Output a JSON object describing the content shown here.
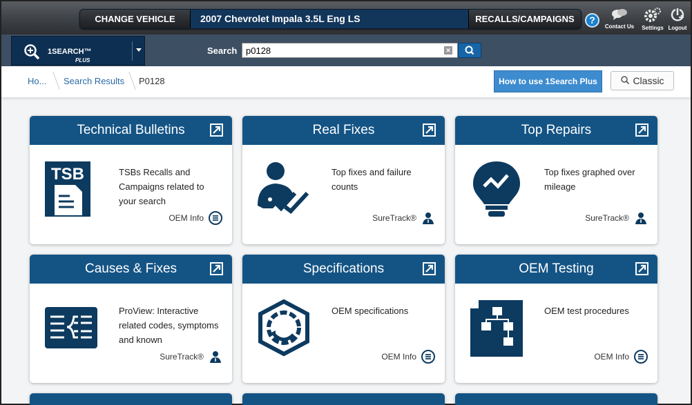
{
  "header": {
    "change_vehicle": "CHANGE VEHICLE",
    "vehicle": "2007 Chevrolet Impala 3.5L Eng LS",
    "recalls": "RECALLS/CAMPAIGNS",
    "help": "?",
    "contact": "Contact Us",
    "settings": "Settings",
    "logout": "Logout"
  },
  "search": {
    "product": "1SEARCH™",
    "product_sub": "PLUS",
    "label": "Search",
    "value": "p0128",
    "clear": "✕"
  },
  "breadcrumb": {
    "home": "Ho...",
    "results": "Search Results",
    "current": "P0128"
  },
  "buttons": {
    "howto": "How to use 1Search Plus",
    "classic": "Classic"
  },
  "cards": [
    {
      "title": "Technical Bulletins",
      "desc": "TSBs Recalls and Campaigns related to your search",
      "source": "OEM Info",
      "icon": "tsb-document-icon"
    },
    {
      "title": "Real Fixes",
      "desc": "Top fixes and failure counts",
      "source": "SureTrack®",
      "icon": "technician-check-icon"
    },
    {
      "title": "Top Repairs",
      "desc": "Top fixes graphed over mileage",
      "source": "SureTrack®",
      "icon": "lightbulb-graph-icon"
    },
    {
      "title": "Causes & Fixes",
      "desc": "ProView: Interactive related codes, symptoms and known",
      "source": "SureTrack®",
      "icon": "tree-list-icon"
    },
    {
      "title": "Specifications",
      "desc": "OEM specifications",
      "source": "OEM Info",
      "icon": "nut-gauge-icon"
    },
    {
      "title": "OEM Testing",
      "desc": "OEM test procedures",
      "source": "OEM Info",
      "icon": "flowchart-icon"
    }
  ],
  "colors": {
    "card_header": "#145485",
    "accent": "#3d8ccf",
    "icon": "#0d3a5f"
  }
}
